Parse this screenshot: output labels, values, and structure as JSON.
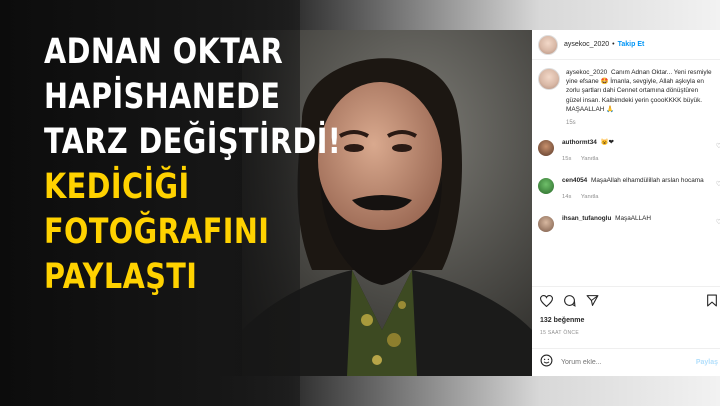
{
  "headline": {
    "line1": "ADNAN OKTAR",
    "line2": "HAPİSHANEDE",
    "line3": "TARZ DEĞİŞTİRDİ!",
    "line4": "KEDİCİĞİ",
    "line5": "FOTOĞRAFINI",
    "line6": "PAYLAŞTI",
    "white_color": "#ffffff",
    "accent_color": "#ffd200"
  },
  "instagram": {
    "header": {
      "username": "aysekoc_2020",
      "separator": "•",
      "follow_label": "Takip Et"
    },
    "caption": {
      "username": "aysekoc_2020",
      "text": "Canım Adnan Oktar... Yeni resmiyle yine efsane 🤩 İmanla, sevgiyle, Allah aşkıyla en zorlu şartları dahi Cennet ortamına dönüştüren güzel insan. Kalbimdeki yerin çoooKKKK büyük. MAŞAALLAH 🙏",
      "time": "15s"
    },
    "comments": [
      {
        "username": "authormt34",
        "text": "😺❤",
        "time": "15s",
        "reply_label": "Yanıtla"
      },
      {
        "username": "cen4054",
        "text": "MaşaAllah elhamdülillah arslan hocama",
        "time": "14s",
        "reply_label": "Yanıtla"
      },
      {
        "username": "ihsan_tufanoglu",
        "text": "MaşaALLAH",
        "time": "",
        "reply_label": ""
      }
    ],
    "likes": "132 beğenme",
    "posted_ago": "15 SAAT ÖNCE",
    "add_comment_placeholder": "Yorum ekle...",
    "post_label": "Paylaş",
    "link_color": "#0095f6"
  }
}
